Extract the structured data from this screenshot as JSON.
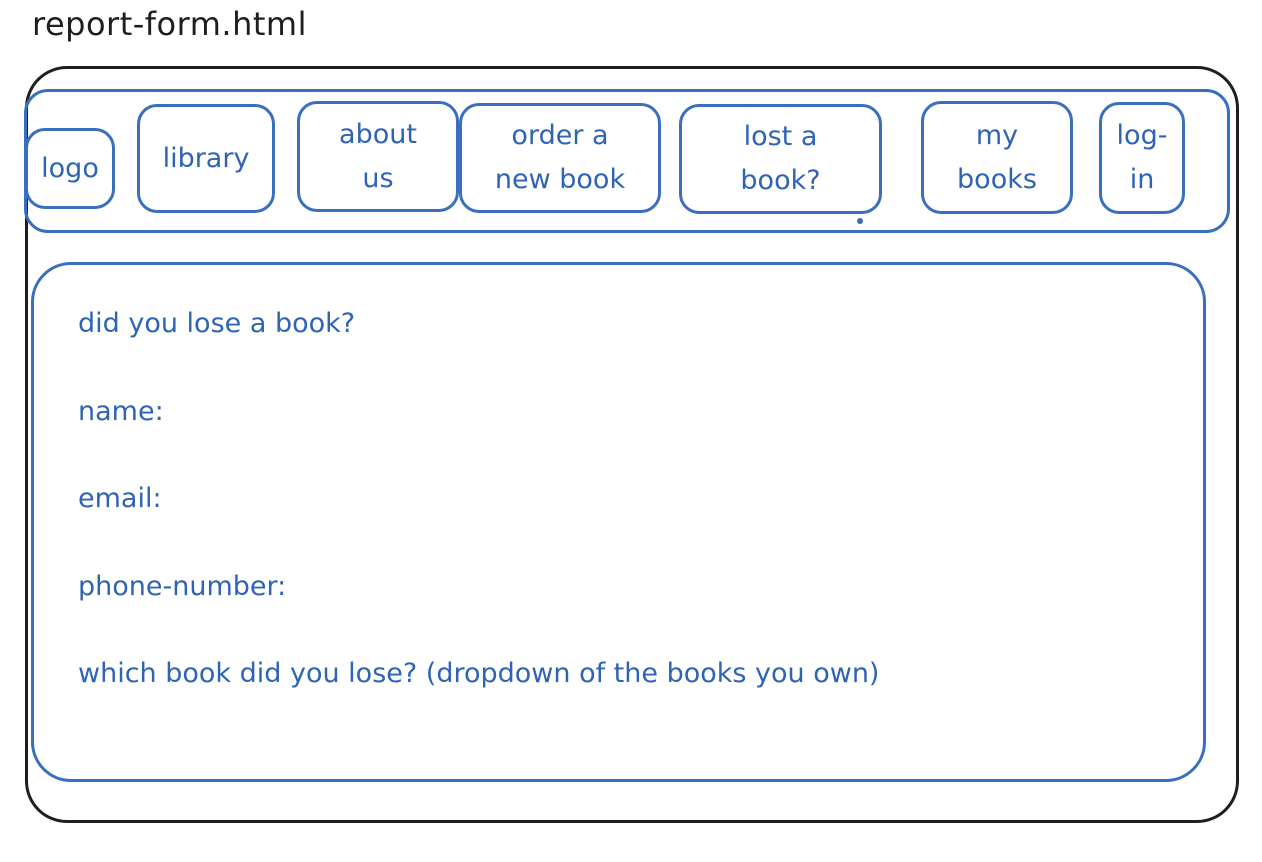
{
  "file_title": "report-form.html",
  "nav": {
    "logo": "logo",
    "library": "library",
    "about_us": "about\nus",
    "order_new_book": "order a\nnew book",
    "lost_book": "lost a\nbook?",
    "my_books": "my\nbooks",
    "log_in": "log-\nin"
  },
  "form": {
    "heading": "did you lose a book?",
    "name_label": "name:",
    "email_label": "email:",
    "phone_label": "phone-number:",
    "book_label": "which book did you lose? (dropdown of the books you own)"
  },
  "colors": {
    "sketch_blue": "#3a6fbf",
    "text_blue": "#2f64b5",
    "frame_black": "#1e1e1e"
  }
}
